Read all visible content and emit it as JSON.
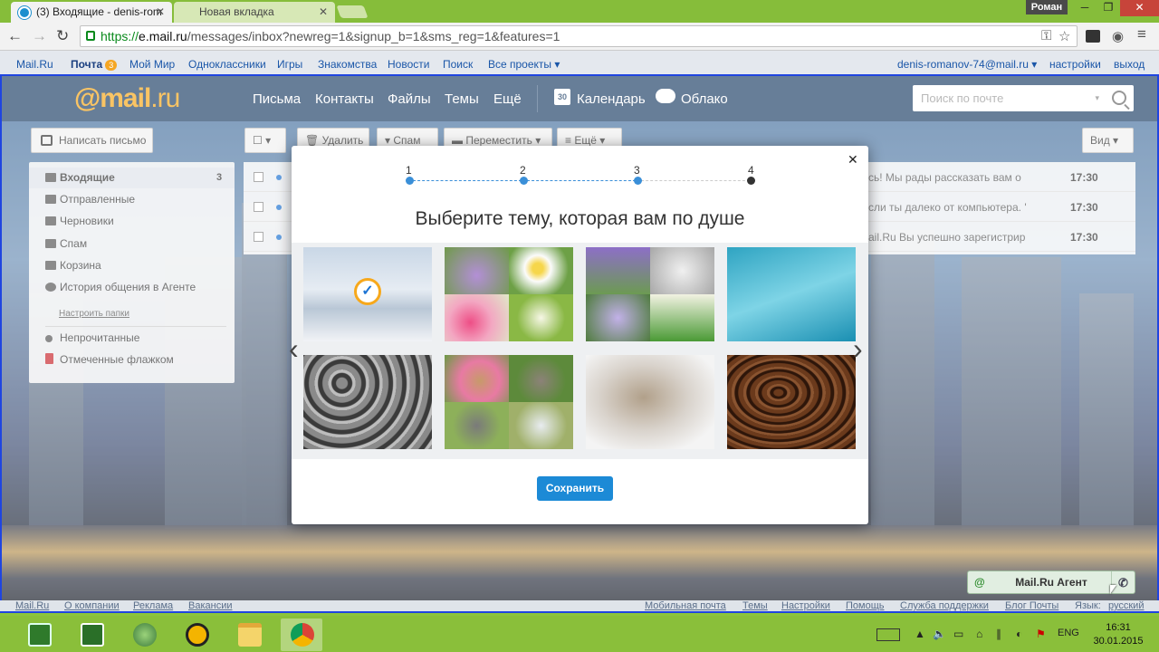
{
  "browser": {
    "tabs": [
      {
        "title": "(3) Входящие - denis-rom"
      },
      {
        "title": "Новая вкладка"
      }
    ],
    "user": "Роман",
    "url": {
      "protocol": "https://",
      "host": "e.mail.ru",
      "path": "/messages/inbox?newreg=1&signup_b=1&sms_reg=1&features=1"
    }
  },
  "portal": {
    "left": [
      "Mail.Ru",
      "Почта",
      "Мой Мир",
      "Одноклассники",
      "Игры",
      "Знакомства",
      "Новости",
      "Поиск",
      "Все проекты"
    ],
    "mail_badge": "3",
    "user_email": "denis-romanov-74@mail.ru",
    "settings": "настройки",
    "logout": "выход"
  },
  "mail": {
    "logo": "@mail",
    "logo_suffix": ".ru",
    "nav": [
      "Письма",
      "Контакты",
      "Файлы",
      "Темы",
      "Ещё"
    ],
    "calendar": "Календарь",
    "calendar_day": "30",
    "cloud": "Облако",
    "search_placeholder": "Поиск по почте",
    "compose": "Написать письмо",
    "toolbar": {
      "delete": "Удалить",
      "spam": "Спам",
      "move": "Переместить",
      "more": "Ещё",
      "view": "Вид"
    },
    "folders": [
      {
        "label": "Входящие",
        "count": "3"
      },
      {
        "label": "Отправленные"
      },
      {
        "label": "Черновики"
      },
      {
        "label": "Спам"
      },
      {
        "label": "Корзина"
      },
      {
        "label": "История общения в Агенте"
      }
    ],
    "setup_folders": "Настроить папки",
    "filters": [
      "Непрочитанные",
      "Отмеченные флажком"
    ],
    "messages": [
      {
        "snippet": "сь! Мы рады рассказать вам о",
        "time": "17:30"
      },
      {
        "snippet": "сли ты далеко от компьютера. '",
        "time": "17:30"
      },
      {
        "snippet": "ail.Ru Вы успешно зарегистрир",
        "time": "17:30"
      }
    ]
  },
  "modal": {
    "steps": [
      "1",
      "2",
      "3",
      "4"
    ],
    "current_step": 4,
    "title": "Выберите тему, которая вам по душе",
    "save": "Сохранить",
    "themes": [
      "city-night",
      "flowers-crocus-daisy-tulip",
      "spring-flowers",
      "sea-water",
      "gravel",
      "kittens",
      "sleeping-kitten",
      "coffee-beans"
    ],
    "selected_theme": "city-night"
  },
  "footer": {
    "left": [
      "Mail.Ru",
      "О компании",
      "Реклама",
      "Вакансии"
    ],
    "right": [
      "Мобильная почта",
      "Темы",
      "Настройки",
      "Помощь",
      "Служба поддержки",
      "Блог Почты",
      "Язык:",
      "русский"
    ]
  },
  "agent": {
    "label": "Mail.Ru Агент"
  },
  "taskbar": {
    "lang": "ENG",
    "time": "16:31",
    "date": "30.01.2015"
  },
  "colors": {
    "accent": "#1c8ad6",
    "header": "#204168",
    "taskbar": "#8abf3a",
    "logo": "#f7a81b"
  }
}
